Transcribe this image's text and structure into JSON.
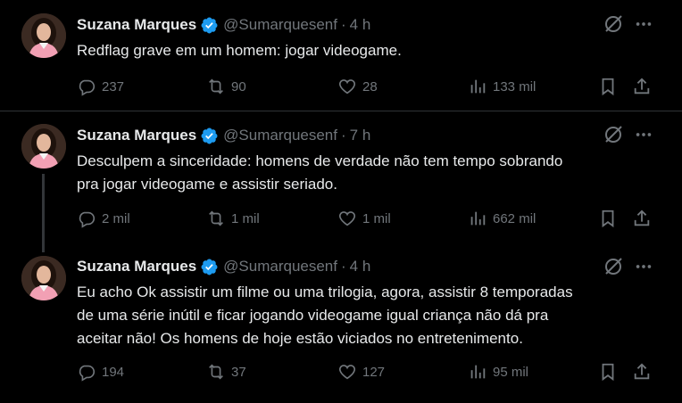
{
  "colors": {
    "background": "#000000",
    "text_primary": "#e7e9ea",
    "text_secondary": "#71767b",
    "verified_blue": "#1d9bf0",
    "divider": "#2f3336"
  },
  "tweets": [
    {
      "author_name": "Suzana Marques",
      "handle": "@Sumarquesenf",
      "separator": "·",
      "time": "4 h",
      "text": "Redflag grave em um homem: jogar videogame.",
      "replies": "237",
      "retweets": "90",
      "likes": "28",
      "views": "133 mil",
      "icons": [
        "avatar",
        "verified-badge-icon",
        "grok-icon",
        "more-icon",
        "reply-icon",
        "retweet-icon",
        "like-icon",
        "views-icon",
        "bookmark-icon",
        "share-icon"
      ]
    },
    {
      "author_name": "Suzana Marques",
      "handle": "@Sumarquesenf",
      "separator": "·",
      "time": "7 h",
      "text": "Desculpem a sinceridade: homens de verdade não tem tempo sobrando\npra jogar videogame e assistir seriado.",
      "replies": "2 mil",
      "retweets": "1 mil",
      "likes": "1 mil",
      "views": "662 mil"
    },
    {
      "author_name": "Suzana Marques",
      "handle": "@Sumarquesenf",
      "separator": "·",
      "time": "4 h",
      "text": "Eu acho Ok assistir um filme ou uma trilogia, agora, assistir 8 temporadas\nde uma série inútil e ficar jogando videogame igual criança não dá pra\naceitar não! Os homens de hoje estão viciados no entretenimento.",
      "replies": "194",
      "retweets": "37",
      "likes": "127",
      "views": "95 mil"
    }
  ]
}
